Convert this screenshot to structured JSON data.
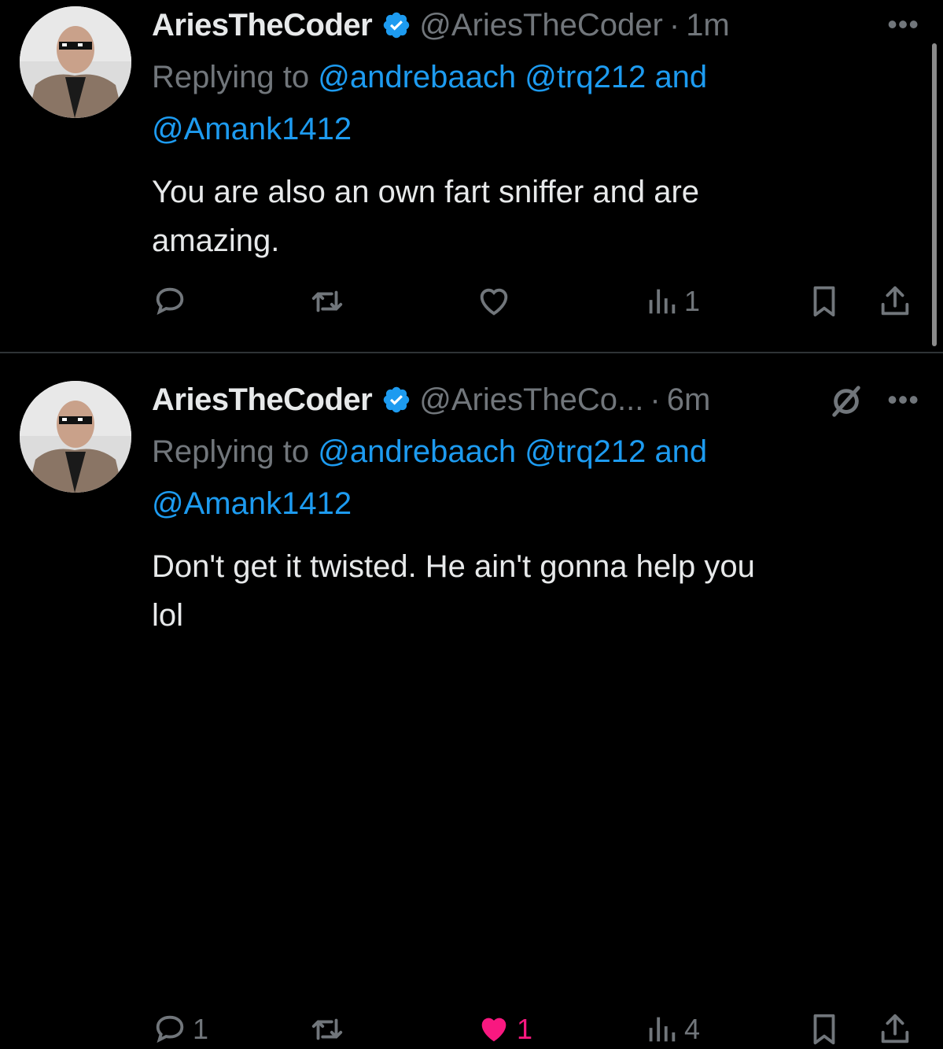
{
  "tweets": [
    {
      "display_name": "AriesTheCoder",
      "handle": "@AriesTheCoder",
      "dot": "·",
      "time": "1m",
      "replying_prefix": "Replying to",
      "mention_1": "@andrebaach",
      "mention_2": "@trq212",
      "and_word": "and",
      "mention_3": "@Amank1412",
      "text_line_1": "You are also an own fart sniffer and are",
      "text_line_2": "amazing.",
      "reply_count": "",
      "like_count": "",
      "view_count": "1",
      "liked": false,
      "muted": false
    },
    {
      "display_name": "AriesTheCoder",
      "handle": "@AriesTheCo...",
      "dot": "·",
      "time": "6m",
      "replying_prefix": "Replying to",
      "mention_1": "@andrebaach",
      "mention_2": "@trq212",
      "and_word": "and",
      "mention_3": "@Amank1412",
      "text_line_1": "Don't get it twisted. He ain't gonna help you",
      "text_line_2": "lol",
      "reply_count": "1",
      "like_count": "1",
      "view_count": "4",
      "liked": true,
      "muted": true
    }
  ],
  "more_label": "•••",
  "colors": {
    "background": "#000000",
    "text": "#e7e9ea",
    "muted": "#71767b",
    "link": "#1d9bf0",
    "like": "#f91880",
    "verified": "#1d9bf0"
  },
  "icons": [
    "reply-icon",
    "retweet-icon",
    "heart-icon",
    "views-icon",
    "bookmark-icon",
    "share-icon",
    "verified-badge-icon",
    "more-icon",
    "mute-icon"
  ]
}
